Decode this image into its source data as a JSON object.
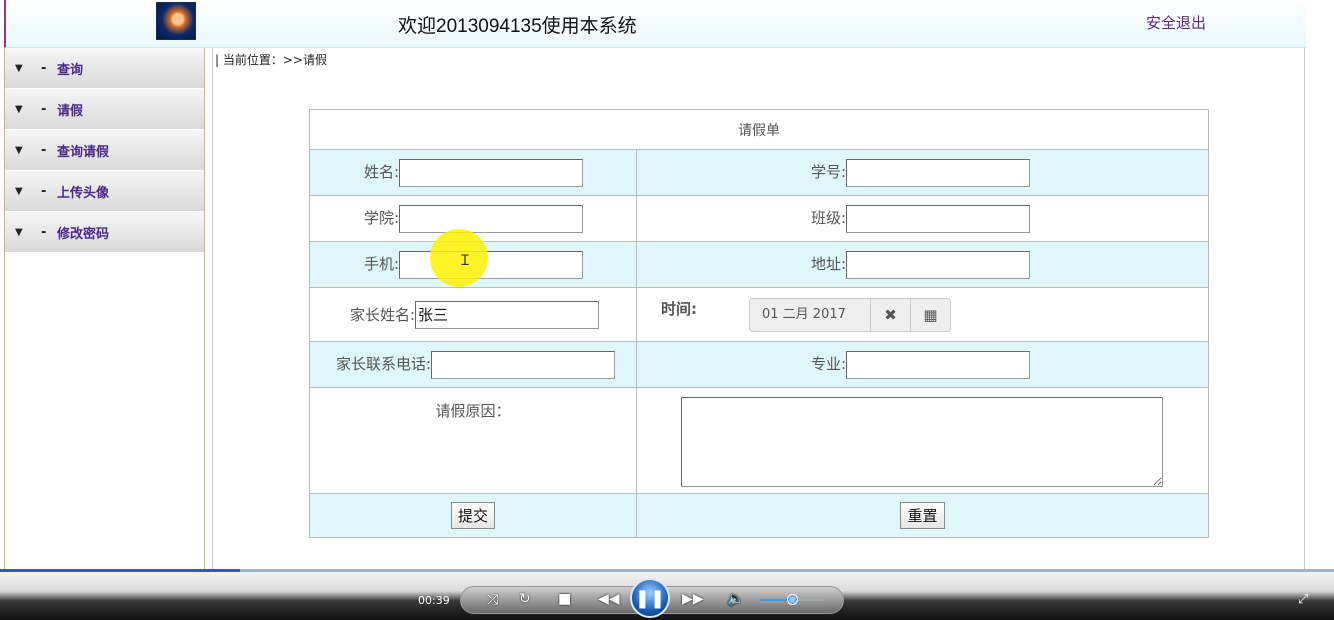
{
  "header": {
    "welcome": "欢迎2013094135使用本系统",
    "logout": "安全退出"
  },
  "sidebar": {
    "items": [
      {
        "label": "查询"
      },
      {
        "label": "请假"
      },
      {
        "label": "查询请假"
      },
      {
        "label": "上传头像"
      },
      {
        "label": "修改密码"
      }
    ],
    "arrow": "▼",
    "dash": "-"
  },
  "breadcrumb": "| 当前位置：>>请假",
  "form": {
    "title": "请假单",
    "name_label": "姓名:",
    "name_value": "",
    "student_id_label": "学号:",
    "student_id_value": "",
    "college_label": "学院:",
    "college_value": "",
    "class_label": "班级:",
    "class_value": "",
    "phone_label": "手机:",
    "phone_value": "",
    "address_label": "地址:",
    "address_value": "",
    "parent_name_label": "家长姓名:",
    "parent_name_value": "张三",
    "time_label": "时间:",
    "date_value": "01 二月 2017",
    "parent_phone_label": "家长联系电话:",
    "parent_phone_value": "",
    "major_label": "专业:",
    "major_value": "",
    "reason_label": "请假原因：",
    "submit": "提交",
    "reset": "重置"
  },
  "player": {
    "time": "00:39",
    "progress": 0.18,
    "volume": 0.5
  }
}
